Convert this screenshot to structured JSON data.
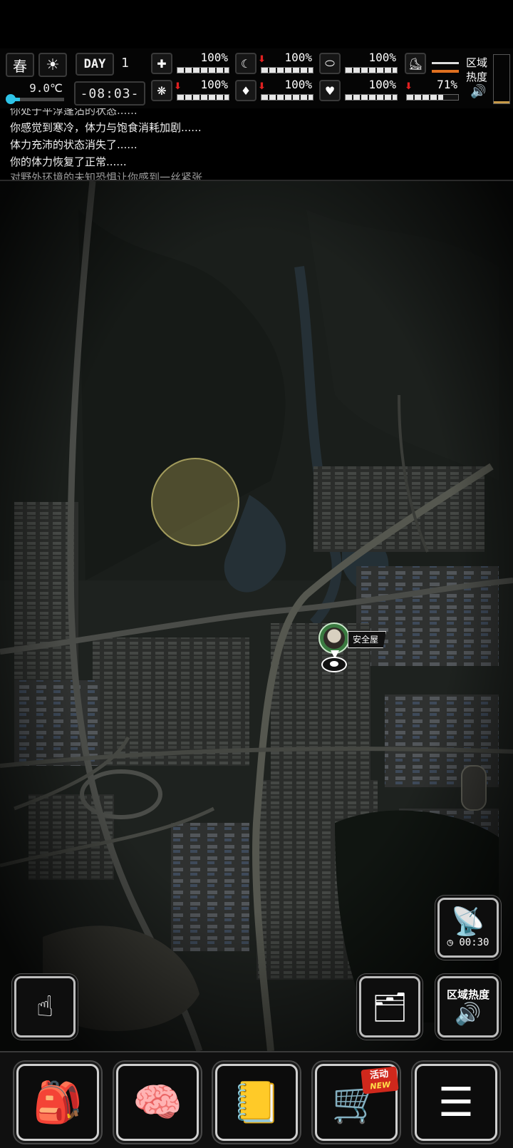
{
  "hud": {
    "season": "春",
    "weather_icon": "sun-icon",
    "temperature": "9.0℃",
    "temperature_level": 0.18,
    "day_label": "DAY",
    "day_number": "1",
    "time": "-08:03-",
    "stats": [
      {
        "id": "health",
        "icon": "medkit-icon",
        "glyph": "✚",
        "value": "100%",
        "level": 1.0,
        "decreasing": false
      },
      {
        "id": "hunger",
        "icon": "stomach-icon",
        "glyph": "☾",
        "value": "100%",
        "level": 1.0,
        "decreasing": true
      },
      {
        "id": "medicine",
        "icon": "pill-icon",
        "glyph": "⬭",
        "value": "100%",
        "level": 1.0,
        "decreasing": false
      },
      {
        "id": "mental",
        "icon": "brain-icon",
        "glyph": "❋",
        "value": "100%",
        "level": 1.0,
        "decreasing": true
      },
      {
        "id": "thirst",
        "icon": "water-drop-icon",
        "glyph": "💧",
        "value": "100%",
        "level": 1.0,
        "decreasing": true
      },
      {
        "id": "mood",
        "icon": "heart-icon",
        "glyph": "♥",
        "value": "100%",
        "level": 1.0,
        "decreasing": false
      },
      {
        "id": "stamina",
        "icon": "battery-icon",
        "glyph": "▭",
        "value": "71%",
        "level": 0.71,
        "decreasing": true
      }
    ],
    "boot_icon": "boot-icon",
    "area_heat_label": "区域热度",
    "area_heat_level": 0.05,
    "speaker_icon": "speaker-icon"
  },
  "log": [
    "你处于平淳蓬沾的状态......",
    "你感觉到寒冷，体力与饱食消耗加剧......",
    "体力充沛的状态消失了......",
    "你的体力恢复了正常......",
    "对野外环境的未知恐惧让你感到一丝紧张......"
  ],
  "map": {
    "marker_label": "安全屋",
    "radar_timer": "00:30",
    "heat_button_label": "区域热度"
  },
  "nav": {
    "items": [
      {
        "id": "backpack",
        "icon": "backpack-icon"
      },
      {
        "id": "skills",
        "icon": "brain-head-icon"
      },
      {
        "id": "journal",
        "icon": "notebook-icon"
      },
      {
        "id": "shop",
        "icon": "shopping-cart-icon"
      },
      {
        "id": "menu",
        "icon": "menu-list-icon"
      }
    ],
    "shop_badge_top": "活动",
    "shop_badge_bottom": "NEW"
  }
}
